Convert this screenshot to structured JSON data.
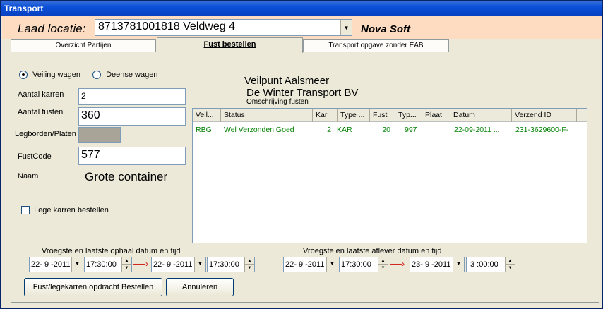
{
  "window": {
    "title": "Transport"
  },
  "header": {
    "laad_label": "Laad locatie:",
    "location_value": "8713781001818  Veldweg  4",
    "brand": "Nova Soft"
  },
  "tabs": [
    {
      "label": "Overzicht Partijen"
    },
    {
      "label": "Fust bestellen"
    },
    {
      "label": "Transport opgave zonder EAB"
    }
  ],
  "form": {
    "radio_veiling": "Veiling wagen",
    "radio_deense": "Deense wagen",
    "aantal_karren_label": "Aantal karren",
    "aantal_karren_value": "2",
    "aantal_fusten_label": "Aantal fusten",
    "aantal_fusten_value": "360",
    "legborden_label": "Legborden/Platen",
    "fustcode_label": "FustCode",
    "fustcode_value": "577",
    "naam_label": "Naam",
    "naam_value": "Grote container",
    "lege_karren_label": "Lege karren bestellen"
  },
  "info": {
    "line1": "Veilpunt Aalsmeer",
    "line2": "De Winter Transport BV",
    "line3": "Omschrijving fusten"
  },
  "table": {
    "columns": [
      "Veil...",
      "Status",
      "Kar",
      "Type ...",
      "Fust",
      "Typ...",
      "Plaat",
      "Datum",
      "Verzend ID"
    ],
    "rows": [
      [
        "RBG",
        "Wel Verzonden Goed",
        "2",
        "KAR",
        "20",
        "997",
        "",
        "22-09-2011 ...",
        "231-3629600-F-"
      ]
    ]
  },
  "pickup": {
    "label": "Vroegste en laatste ophaal datum en tijd",
    "from_date": "22- 9 -2011",
    "from_time": "17:30:00",
    "to_date": "22- 9 -2011",
    "to_time": "17:30:00"
  },
  "delivery": {
    "label": "Vroegste en laatste aflever datum en tijd",
    "from_date": "22- 9 -2011",
    "from_time": "17:30:00",
    "to_date": "23- 9 -2011",
    "to_time": "3 :00:00"
  },
  "buttons": {
    "order": "Fust/legekarren opdracht Bestellen",
    "cancel": "Annuleren"
  },
  "colors": {
    "header_bg": "#fddcc2",
    "row_text": "#008000",
    "arrow": "#d00000",
    "titlebar": "#0a50d8"
  }
}
